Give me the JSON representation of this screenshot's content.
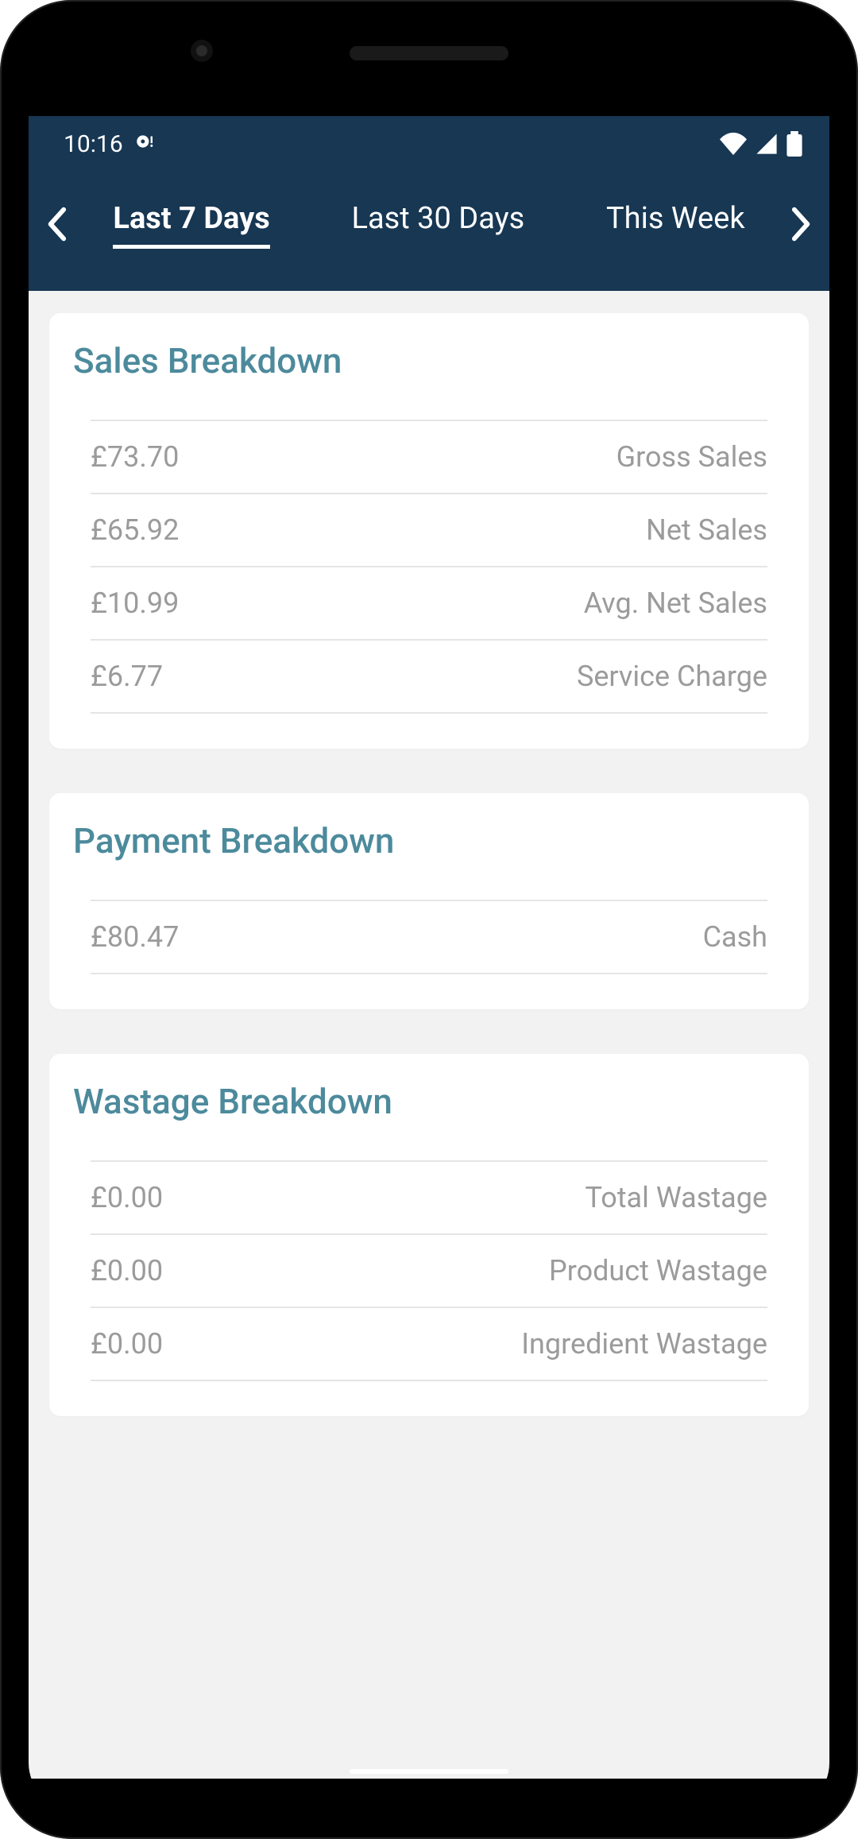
{
  "status": {
    "time": "10:16"
  },
  "header": {
    "tabs": [
      {
        "label": "Last 7 Days",
        "active": true
      },
      {
        "label": "Last 30 Days",
        "active": false
      },
      {
        "label": "This Week",
        "active": false
      }
    ]
  },
  "cards": [
    {
      "title": "Sales Breakdown",
      "rows": [
        {
          "value": "£73.70",
          "label": "Gross Sales"
        },
        {
          "value": "£65.92",
          "label": "Net Sales"
        },
        {
          "value": "£10.99",
          "label": "Avg. Net Sales"
        },
        {
          "value": "£6.77",
          "label": "Service Charge"
        }
      ]
    },
    {
      "title": "Payment Breakdown",
      "rows": [
        {
          "value": "£80.47",
          "label": "Cash"
        }
      ]
    },
    {
      "title": "Wastage Breakdown",
      "rows": [
        {
          "value": "£0.00",
          "label": "Total Wastage"
        },
        {
          "value": "£0.00",
          "label": "Product Wastage"
        },
        {
          "value": "£0.00",
          "label": "Ingredient Wastage"
        }
      ]
    }
  ]
}
